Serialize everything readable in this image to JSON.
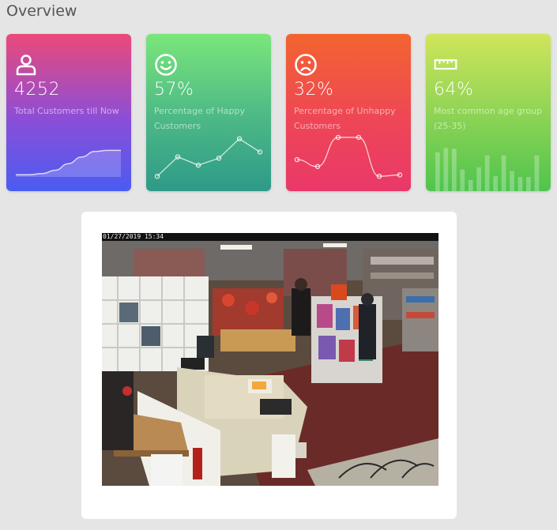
{
  "page": {
    "title": "Overview"
  },
  "cards": [
    {
      "value": "4252",
      "label": "Total Customers till Now",
      "icon": "user-icon",
      "sparkline": {
        "type": "area",
        "values": [
          2,
          2,
          3,
          6,
          12,
          18,
          23,
          24,
          24
        ]
      }
    },
    {
      "value": "57%",
      "label": "Percentage of Happy Customers",
      "icon": "smile-face-icon",
      "sparkline": {
        "type": "line",
        "values": [
          10,
          38,
          26,
          36,
          64,
          45
        ]
      }
    },
    {
      "value": "32%",
      "label": "Percentage of Unhappy Customers",
      "icon": "sad-face-icon",
      "sparkline": {
        "type": "line",
        "values": [
          34,
          24,
          66,
          66,
          10,
          12
        ]
      }
    },
    {
      "value": "64%",
      "label": "Most common age group (25-35)",
      "icon": "ruler-icon",
      "sparkline": {
        "type": "bar",
        "values": [
          52,
          58,
          57,
          29,
          15,
          32,
          48,
          20,
          48,
          27,
          19,
          19,
          48
        ]
      }
    }
  ],
  "camera": {
    "timestamp": "01/27/2019 15:34",
    "feed": "store-cctv-feed"
  },
  "colors": {
    "background": "#e5e5e5",
    "card1": "#8a4ed8",
    "card2": "#4fbb86",
    "card3": "#ee4656",
    "card4": "#8fd455"
  }
}
